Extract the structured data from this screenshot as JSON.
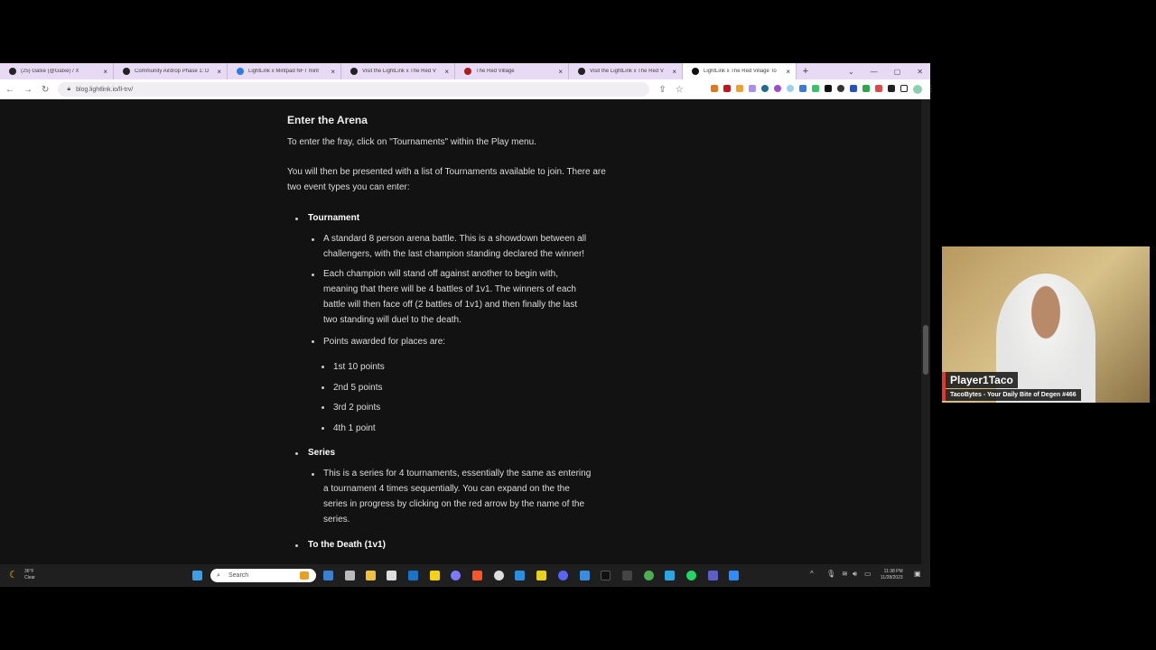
{
  "browser": {
    "tabs": [
      {
        "title": "(25) Galxe (@Galxe) / X",
        "color": "#222"
      },
      {
        "title": "Community Airdrop Phase 1: D",
        "color": "#222"
      },
      {
        "title": "LightLink x Mintpad NFT mint",
        "color": "#2a7de1"
      },
      {
        "title": "Visit the LightLink x The Red V",
        "color": "#222"
      },
      {
        "title": "The Red Village",
        "color": "#b01c1c"
      },
      {
        "title": "Visit the LightLink x The Red V",
        "color": "#222"
      },
      {
        "title": "LightLink x The Red Village To",
        "color": "#111",
        "active": true
      }
    ],
    "url": "blog.lightlink.io/ll-trv/"
  },
  "article": {
    "heading": "Enter the Arena",
    "intro": "To enter the fray, click on \"Tournaments\" within the Play menu.",
    "para2_l1": "You will then be presented with a list of Tournaments available to join. There are",
    "para2_l2": "two event types you can enter:",
    "tournament": {
      "title": "Tournament",
      "b1": [
        "A standard 8 person arena battle. This is a showdown between all",
        "challengers, with the last champion standing declared the winner!"
      ],
      "b2": [
        "Each champion will stand off against another to begin with,",
        "meaning that there will be 4 battles of 1v1. The winners of each",
        "battle will then face off (2 battles of 1v1) and then finally the last",
        "two standing will duel to the death."
      ],
      "b3": "Points awarded for places are:",
      "points": [
        "1st 10 points",
        "2nd 5 points",
        "3rd 2 points",
        "4th 1 point"
      ]
    },
    "series": {
      "title": "Series",
      "b1": [
        "This is a series for 4 tournaments, essentially the same as entering",
        "a tournament 4 times sequentially. You can expand on the the",
        "series in progress by clicking on the red arrow by the name of the",
        "series."
      ]
    },
    "death": {
      "title": "To the Death (1v1)"
    }
  },
  "taskbar": {
    "weather_temp": "36°F",
    "weather_cond": "Clear",
    "search": "Search",
    "time": "11:38 PM",
    "date": "11/28/2023"
  },
  "overlay": {
    "name": "Player1Taco",
    "subtitle": "TacoBytes - Your Daily Bite of Degen #466",
    "accent": "#e03a2a"
  }
}
